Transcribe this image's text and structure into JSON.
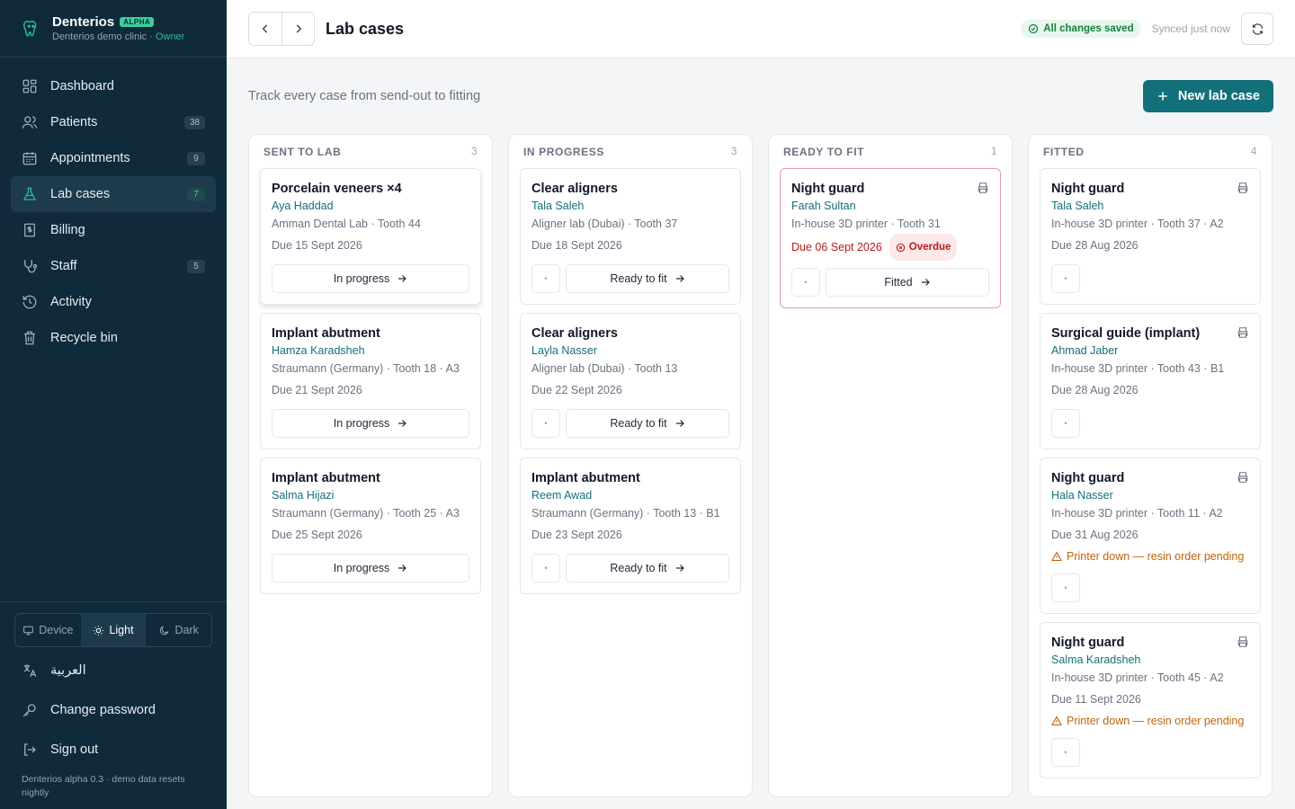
{
  "brand": {
    "name": "Denterios",
    "badge": "ALPHA",
    "clinic": "Denterios demo clinic ·",
    "role": "Owner"
  },
  "nav": [
    {
      "label": "Dashboard",
      "icon": "dashboard-icon",
      "count": ""
    },
    {
      "label": "Patients",
      "icon": "users-icon",
      "count": "38"
    },
    {
      "label": "Appointments",
      "icon": "calendar-icon",
      "count": "9"
    },
    {
      "label": "Lab cases",
      "icon": "flask-icon",
      "count": "7",
      "active": true
    },
    {
      "label": "Billing",
      "icon": "billing-icon",
      "count": ""
    },
    {
      "label": "Staff",
      "icon": "stethoscope-icon",
      "count": "5"
    },
    {
      "label": "Activity",
      "icon": "history-icon",
      "count": ""
    },
    {
      "label": "Recycle bin",
      "icon": "trash-icon",
      "count": ""
    }
  ],
  "theme": {
    "device": "Device",
    "light": "Light",
    "dark": "Dark",
    "selected": "Light"
  },
  "bottom": {
    "language": "العربية",
    "change_password": "Change password",
    "sign_out": "Sign out",
    "version": "Denterios alpha 0.3 · demo data resets nightly"
  },
  "topbar": {
    "title": "Lab cases",
    "saved": "All changes saved",
    "synced": "Synced just now"
  },
  "subhead": {
    "text": "Track every case from send-out to fitting",
    "new_button": "New lab case"
  },
  "columns": [
    {
      "title": "SENT TO LAB",
      "count": "3",
      "cards": [
        {
          "title": "Porcelain veneers ×4",
          "patient": "Aya Haddad",
          "meta": "Amman Dental Lab · Tooth 44",
          "due": "Due 15 Sept 2026",
          "action": "In progress",
          "has_back": false,
          "printable": false,
          "raised": true
        },
        {
          "title": "Implant abutment",
          "patient": "Hamza Karadsheh",
          "meta": "Straumann (Germany) · Tooth 18 · A3",
          "due": "Due 21 Sept 2026",
          "action": "In progress",
          "has_back": false,
          "printable": false
        },
        {
          "title": "Implant abutment",
          "patient": "Salma Hijazi",
          "meta": "Straumann (Germany) · Tooth 25 · A3",
          "due": "Due 25 Sept 2026",
          "action": "In progress",
          "has_back": false,
          "printable": false
        }
      ]
    },
    {
      "title": "IN PROGRESS",
      "count": "3",
      "cards": [
        {
          "title": "Clear aligners",
          "patient": "Tala Saleh",
          "meta": "Aligner lab (Dubai) · Tooth 37",
          "due": "Due 18 Sept 2026",
          "action": "Ready to fit",
          "has_back": true,
          "printable": false
        },
        {
          "title": "Clear aligners",
          "patient": "Layla Nasser",
          "meta": "Aligner lab (Dubai) · Tooth 13",
          "due": "Due 22 Sept 2026",
          "action": "Ready to fit",
          "has_back": true,
          "printable": false
        },
        {
          "title": "Implant abutment",
          "patient": "Reem Awad",
          "meta": "Straumann (Germany) · Tooth 13 · B1",
          "due": "Due 23 Sept 2026",
          "action": "Ready to fit",
          "has_back": true,
          "printable": false
        }
      ]
    },
    {
      "title": "READY TO FIT",
      "count": "1",
      "cards": [
        {
          "title": "Night guard",
          "patient": "Farah Sultan",
          "meta": "In-house 3D printer · Tooth 31",
          "due": "Due 06 Sept 2026",
          "overdue": "Overdue",
          "action": "Fitted",
          "has_back": true,
          "printable": true
        }
      ]
    },
    {
      "title": "FITTED",
      "count": "4",
      "cards": [
        {
          "title": "Night guard",
          "patient": "Tala Saleh",
          "meta": "In-house 3D printer · Tooth 37 · A2",
          "due": "Due 28 Aug 2026",
          "action": "",
          "has_back": true,
          "printable": true
        },
        {
          "title": "Surgical guide (implant)",
          "patient": "Ahmad Jaber",
          "meta": "In-house 3D printer · Tooth 43 · B1",
          "due": "Due 28 Aug 2026",
          "action": "",
          "has_back": true,
          "printable": true
        },
        {
          "title": "Night guard",
          "patient": "Hala Nasser",
          "meta": "In-house 3D printer · Tooth 11 · A2",
          "due": "Due 31 Aug 2026",
          "warning": "Printer down — resin order pending",
          "action": "",
          "has_back": true,
          "printable": true
        },
        {
          "title": "Night guard",
          "patient": "Salma Karadsheh",
          "meta": "In-house 3D printer · Tooth 45 · A2",
          "due": "Due 11 Sept 2026",
          "warning": "Printer down — resin order pending",
          "action": "",
          "has_back": true,
          "printable": true
        }
      ]
    }
  ],
  "colors": {
    "sidebar_bg": "#0f2a3a",
    "accent": "#12707a",
    "overdue": "#b91c1c",
    "warning": "#c2620a",
    "saved": "#16803c"
  }
}
